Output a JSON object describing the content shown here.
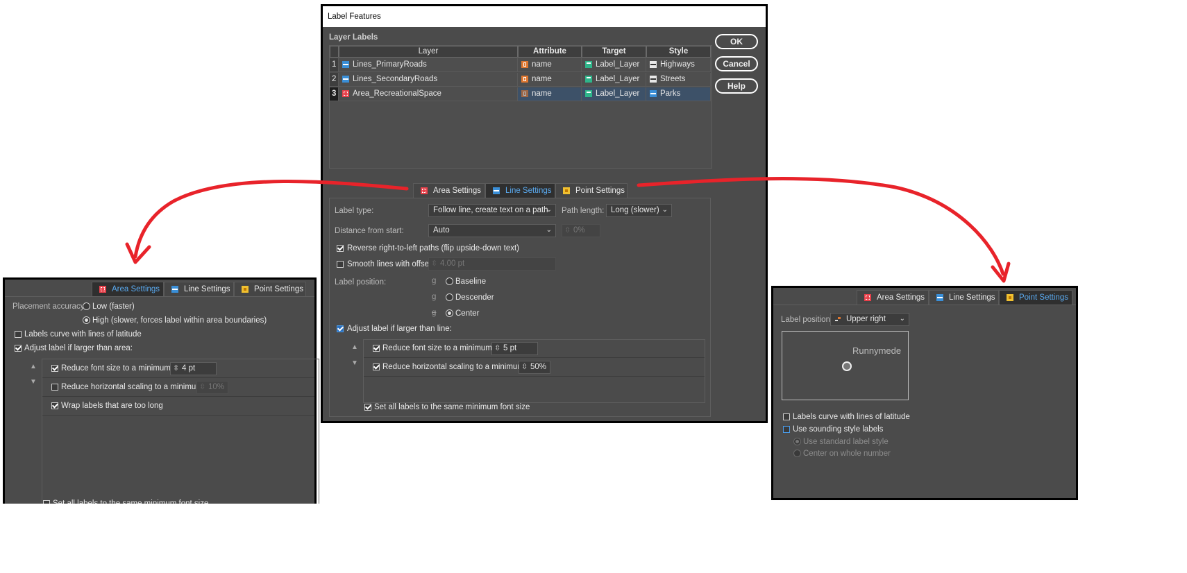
{
  "dialog": {
    "title": "Label Features",
    "section_title": "Layer Labels",
    "buttons": {
      "ok": "OK",
      "cancel": "Cancel",
      "help": "Help"
    },
    "table": {
      "columns": [
        "Layer",
        "Attribute",
        "Target",
        "Style"
      ],
      "rows": [
        {
          "num": "1",
          "layer": "Lines_PrimaryRoads",
          "attribute": "name",
          "target": "Label_Layer",
          "style": "Highways"
        },
        {
          "num": "2",
          "layer": "Lines_SecondaryRoads",
          "attribute": "name",
          "target": "Label_Layer",
          "style": "Streets"
        },
        {
          "num": "3",
          "layer": "Area_RecreationalSpace",
          "attribute": "name",
          "target": "Label_Layer",
          "style": "Parks"
        }
      ]
    },
    "tabs": [
      "Area Settings",
      "Line Settings",
      "Point Settings"
    ],
    "active_tab": "Line Settings",
    "line_settings": {
      "label_type_label": "Label type:",
      "label_type_value": "Follow line, create text on a path",
      "path_length_label": "Path length:",
      "path_length_value": "Long (slower)",
      "distance_label": "Distance from start:",
      "distance_value": "Auto",
      "distance_pct": "0%",
      "reverse_label": "Reverse right-to-left paths (flip upside-down text)",
      "reverse_checked": true,
      "smooth_label": "Smooth lines with offset:",
      "smooth_checked": false,
      "smooth_value": "4.00 pt",
      "label_position_label": "Label position:",
      "positions": [
        "Baseline",
        "Descender",
        "Center"
      ],
      "position_glyph": "g",
      "position_selected": "Center",
      "adjust_label": "Adjust label if larger than line:",
      "adjust_checked": true,
      "reduce_font_label": "Reduce font size to a minimum of:",
      "reduce_font_value": "5 pt",
      "reduce_scaling_label": "Reduce horizontal scaling to a minimum of:",
      "reduce_scaling_value": "50%",
      "same_min_label": "Set all labels to the same minimum font size"
    }
  },
  "area_panel": {
    "tabs": [
      "Area Settings",
      "Line Settings",
      "Point Settings"
    ],
    "active_tab": "Area Settings",
    "placement_label": "Placement accuracy:",
    "placement_options": [
      "Low (faster)",
      "High (slower, forces label within area boundaries)"
    ],
    "placement_selected": "High (slower, forces label within area boundaries)",
    "curve_label": "Labels curve with lines of latitude",
    "adjust_label": "Adjust label if larger than area:",
    "reduce_font_label": "Reduce font size to a minimum of:",
    "reduce_font_value": "4 pt",
    "reduce_scaling_label": "Reduce horizontal scaling to a minimum of:",
    "reduce_scaling_value": "10%",
    "wrap_label": "Wrap labels that are too long",
    "same_min_label": "Set all labels to the same minimum font size"
  },
  "point_panel": {
    "tabs": [
      "Area Settings",
      "Line Settings",
      "Point Settings"
    ],
    "active_tab": "Point Settings",
    "label_position_label": "Label position:",
    "label_position_value": "Upper right",
    "preview_text": "Runnymede",
    "curve_label": "Labels curve with lines of latitude",
    "sounding_label": "Use sounding style labels",
    "sounding_options": [
      "Use standard label style",
      "Center on whole number"
    ]
  },
  "colors": {
    "panel_bg": "#4b4b4b",
    "active_tab_text": "#5aaaf0",
    "arrow": "#e8232a",
    "selected_row": "#3d5168"
  },
  "icons": [
    "area-icon",
    "line-icon",
    "point-icon",
    "attribute-icon",
    "target-icon",
    "style-icon"
  ]
}
